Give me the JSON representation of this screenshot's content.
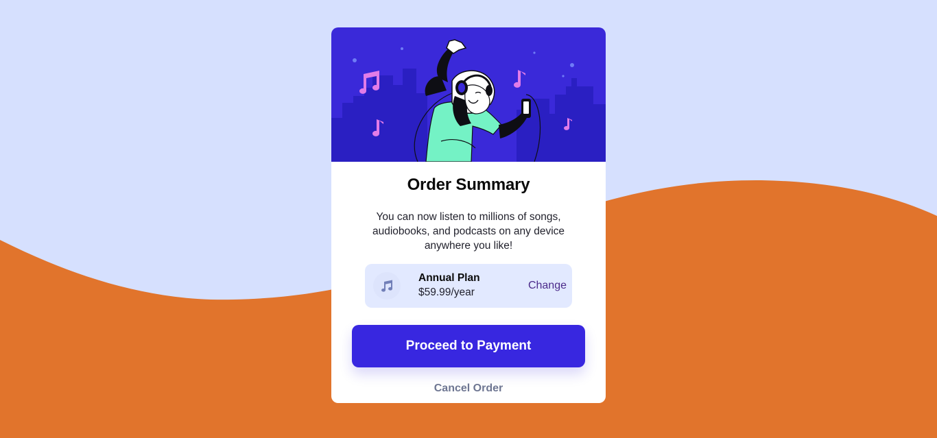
{
  "colors": {
    "page_background": "#d6e0fe",
    "wave": "#e1742c",
    "card_background": "#ffffff",
    "hero_background": "#3a29d9",
    "accent": "#3827e0",
    "plan_box_background": "#e2e9ff",
    "change_link": "#4b2a8a",
    "cancel_link": "#6e7692"
  },
  "hero": {
    "illustration": "person-dancing-with-headphones-illustration"
  },
  "summary": {
    "title": "Order Summary",
    "description": "You can now listen to millions of songs, audiobooks, and podcasts on any device anywhere you like!"
  },
  "plan": {
    "icon": "music-note-icon",
    "name": "Annual Plan",
    "price": "$59.99/year",
    "change_label": "Change"
  },
  "actions": {
    "proceed_label": "Proceed to Payment",
    "cancel_label": "Cancel Order"
  }
}
